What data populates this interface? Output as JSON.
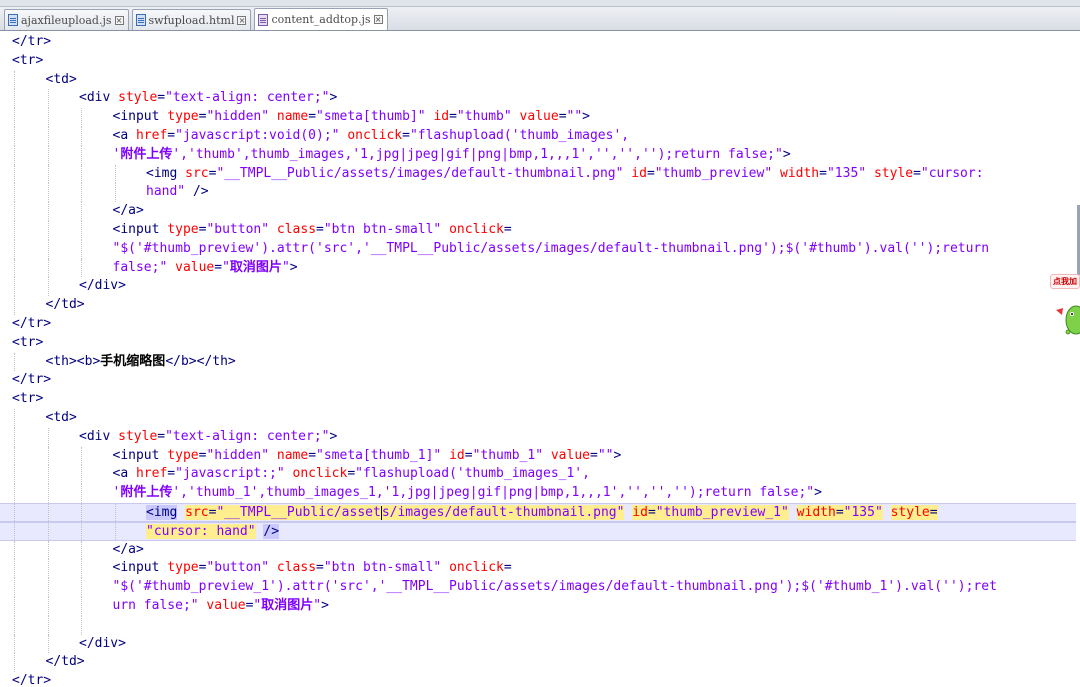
{
  "tabs": [
    {
      "label": "ajaxfileupload.js",
      "icon": "file-js-icon"
    },
    {
      "label": "swfupload.html",
      "icon": "file-html-icon"
    },
    {
      "label": "content_addtop.js",
      "icon": "file-js-icon"
    }
  ],
  "side_badge": "点我加",
  "colors": {
    "tag": "#000080",
    "attribute": "#ff0000",
    "value": "#8000ff",
    "current_line": "#e8e8ff",
    "highlight": "#ffee8f"
  },
  "code_lines": [
    {
      "indent": 0,
      "tokens": [
        {
          "c": "t",
          "x": "</tr>"
        }
      ]
    },
    {
      "indent": 0,
      "tokens": [
        {
          "c": "t",
          "x": "<tr>"
        }
      ]
    },
    {
      "indent": 1,
      "tokens": [
        {
          "c": "t",
          "x": "<td>"
        }
      ]
    },
    {
      "indent": 2,
      "tokens": [
        {
          "c": "t",
          "x": "<div "
        },
        {
          "c": "a",
          "x": "style"
        },
        {
          "c": "t",
          "x": "="
        },
        {
          "c": "v",
          "x": "\"text-align: center;\""
        },
        {
          "c": "t",
          "x": ">"
        }
      ]
    },
    {
      "indent": 3,
      "tokens": [
        {
          "c": "t",
          "x": "<input "
        },
        {
          "c": "a",
          "x": "type"
        },
        {
          "c": "t",
          "x": "="
        },
        {
          "c": "v",
          "x": "\"hidden\""
        },
        {
          "c": "t",
          "x": " "
        },
        {
          "c": "a",
          "x": "name"
        },
        {
          "c": "t",
          "x": "="
        },
        {
          "c": "v",
          "x": "\"smeta[thumb]\""
        },
        {
          "c": "t",
          "x": " "
        },
        {
          "c": "a",
          "x": "id"
        },
        {
          "c": "t",
          "x": "="
        },
        {
          "c": "v",
          "x": "\"thumb\""
        },
        {
          "c": "t",
          "x": " "
        },
        {
          "c": "a",
          "x": "value"
        },
        {
          "c": "t",
          "x": "="
        },
        {
          "c": "v",
          "x": "\"\""
        },
        {
          "c": "t",
          "x": ">"
        }
      ]
    },
    {
      "indent": 3,
      "tokens": [
        {
          "c": "t",
          "x": "<a "
        },
        {
          "c": "a",
          "x": "href"
        },
        {
          "c": "t",
          "x": "="
        },
        {
          "c": "v",
          "x": "\"javascript:void(0);\""
        },
        {
          "c": "t",
          "x": " "
        },
        {
          "c": "a",
          "x": "onclick"
        },
        {
          "c": "t",
          "x": "="
        },
        {
          "c": "v",
          "x": "\"flashupload('thumb_images',"
        }
      ]
    },
    {
      "indent": 3,
      "tokens": [
        {
          "c": "v",
          "x": "'"
        },
        {
          "c": "cjkv",
          "x": "附件上传"
        },
        {
          "c": "v",
          "x": "','thumb',thumb_images,'1,jpg|jpeg|gif|png|bmp,1,,,1','','','');return false;\""
        },
        {
          "c": "t",
          "x": ">"
        }
      ]
    },
    {
      "indent": 4,
      "tokens": [
        {
          "c": "t",
          "x": "<img "
        },
        {
          "c": "a",
          "x": "src"
        },
        {
          "c": "t",
          "x": "="
        },
        {
          "c": "v",
          "x": "\"__TMPL__Public/assets/images/default-thumbnail.png\""
        },
        {
          "c": "t",
          "x": " "
        },
        {
          "c": "a",
          "x": "id"
        },
        {
          "c": "t",
          "x": "="
        },
        {
          "c": "v",
          "x": "\"thumb_preview\""
        },
        {
          "c": "t",
          "x": " "
        },
        {
          "c": "a",
          "x": "width"
        },
        {
          "c": "t",
          "x": "="
        },
        {
          "c": "v",
          "x": "\"135\""
        },
        {
          "c": "t",
          "x": " "
        },
        {
          "c": "a",
          "x": "style"
        },
        {
          "c": "t",
          "x": "="
        },
        {
          "c": "v",
          "x": "\"cursor:"
        }
      ]
    },
    {
      "indent": 4,
      "tokens": [
        {
          "c": "v",
          "x": "hand\""
        },
        {
          "c": "t",
          "x": " />"
        }
      ]
    },
    {
      "indent": 3,
      "tokens": [
        {
          "c": "t",
          "x": "</a>"
        }
      ]
    },
    {
      "indent": 3,
      "tokens": [
        {
          "c": "t",
          "x": "<input "
        },
        {
          "c": "a",
          "x": "type"
        },
        {
          "c": "t",
          "x": "="
        },
        {
          "c": "v",
          "x": "\"button\""
        },
        {
          "c": "t",
          "x": " "
        },
        {
          "c": "a",
          "x": "class"
        },
        {
          "c": "t",
          "x": "="
        },
        {
          "c": "v",
          "x": "\"btn btn-small\""
        },
        {
          "c": "t",
          "x": " "
        },
        {
          "c": "a",
          "x": "onclick"
        },
        {
          "c": "t",
          "x": "="
        }
      ]
    },
    {
      "indent": 3,
      "tokens": [
        {
          "c": "v",
          "x": "\"$('#thumb_preview').attr('src','__TMPL__Public/assets/images/default-thumbnail.png');$('#thumb').val('');return"
        }
      ]
    },
    {
      "indent": 3,
      "tokens": [
        {
          "c": "v",
          "x": "false;\""
        },
        {
          "c": "t",
          "x": " "
        },
        {
          "c": "a",
          "x": "value"
        },
        {
          "c": "t",
          "x": "="
        },
        {
          "c": "v",
          "x": "\""
        },
        {
          "c": "cjkv",
          "x": "取消图片"
        },
        {
          "c": "v",
          "x": "\""
        },
        {
          "c": "t",
          "x": ">"
        }
      ]
    },
    {
      "indent": 2,
      "tokens": [
        {
          "c": "t",
          "x": "</div>"
        }
      ]
    },
    {
      "indent": 1,
      "tokens": [
        {
          "c": "t",
          "x": "</td>"
        }
      ]
    },
    {
      "indent": 0,
      "tokens": [
        {
          "c": "t",
          "x": "</tr>"
        }
      ]
    },
    {
      "indent": 0,
      "tokens": [
        {
          "c": "t",
          "x": "<tr>"
        }
      ]
    },
    {
      "indent": 1,
      "tokens": [
        {
          "c": "t",
          "x": "<th><b>"
        },
        {
          "c": "cjk",
          "x": "手机缩略图"
        },
        {
          "c": "t",
          "x": "</b></th>"
        }
      ]
    },
    {
      "indent": 0,
      "tokens": [
        {
          "c": "t",
          "x": "</tr>"
        }
      ]
    },
    {
      "indent": 0,
      "tokens": [
        {
          "c": "t",
          "x": "<tr>"
        }
      ]
    },
    {
      "indent": 1,
      "tokens": [
        {
          "c": "t",
          "x": "<td>"
        }
      ]
    },
    {
      "indent": 2,
      "tokens": [
        {
          "c": "t",
          "x": "<div "
        },
        {
          "c": "a",
          "x": "style"
        },
        {
          "c": "t",
          "x": "="
        },
        {
          "c": "v",
          "x": "\"text-align: center;\""
        },
        {
          "c": "t",
          "x": ">"
        }
      ]
    },
    {
      "indent": 3,
      "tokens": [
        {
          "c": "t",
          "x": "<input "
        },
        {
          "c": "a",
          "x": "type"
        },
        {
          "c": "t",
          "x": "="
        },
        {
          "c": "v",
          "x": "\"hidden\""
        },
        {
          "c": "t",
          "x": " "
        },
        {
          "c": "a",
          "x": "name"
        },
        {
          "c": "t",
          "x": "="
        },
        {
          "c": "v",
          "x": "\"smeta[thumb_1]\""
        },
        {
          "c": "t",
          "x": " "
        },
        {
          "c": "a",
          "x": "id"
        },
        {
          "c": "t",
          "x": "="
        },
        {
          "c": "v",
          "x": "\"thumb_1\""
        },
        {
          "c": "t",
          "x": " "
        },
        {
          "c": "a",
          "x": "value"
        },
        {
          "c": "t",
          "x": "="
        },
        {
          "c": "v",
          "x": "\"\""
        },
        {
          "c": "t",
          "x": ">"
        }
      ]
    },
    {
      "indent": 3,
      "tokens": [
        {
          "c": "t",
          "x": "<a "
        },
        {
          "c": "a",
          "x": "href"
        },
        {
          "c": "t",
          "x": "="
        },
        {
          "c": "v",
          "x": "\"javascript:;\""
        },
        {
          "c": "t",
          "x": " "
        },
        {
          "c": "a",
          "x": "onclick"
        },
        {
          "c": "t",
          "x": "="
        },
        {
          "c": "v",
          "x": "\"flashupload('thumb_images_1',"
        }
      ]
    },
    {
      "indent": 3,
      "tokens": [
        {
          "c": "v",
          "x": "'"
        },
        {
          "c": "cjkv",
          "x": "附件上传"
        },
        {
          "c": "v",
          "x": "','thumb_1',thumb_images_1,'1,jpg|jpeg|gif|png|bmp,1,,,1','','','');return false;\""
        },
        {
          "c": "t",
          "x": ">"
        }
      ]
    },
    {
      "indent": 4,
      "current": true,
      "tokens": [
        {
          "c": "t hl-tag",
          "x": "<img"
        },
        {
          "c": "t",
          "x": " "
        },
        {
          "c": "a hl",
          "x": "src"
        },
        {
          "c": "t hl",
          "x": "="
        },
        {
          "c": "v hl",
          "x": "\"__TMPL__Public/asset"
        },
        {
          "c": "caret",
          "x": ""
        },
        {
          "c": "v hl",
          "x": "s/images/default-thumbnail.png\""
        },
        {
          "c": "t",
          "x": " "
        },
        {
          "c": "a hl",
          "x": "id"
        },
        {
          "c": "t hl",
          "x": "="
        },
        {
          "c": "v hl",
          "x": "\"thumb_preview_1\""
        },
        {
          "c": "t",
          "x": " "
        },
        {
          "c": "a hl",
          "x": "width"
        },
        {
          "c": "t hl",
          "x": "="
        },
        {
          "c": "v hl",
          "x": "\"135\""
        },
        {
          "c": "t",
          "x": " "
        },
        {
          "c": "a hl",
          "x": "style"
        },
        {
          "c": "t hl",
          "x": "="
        }
      ]
    },
    {
      "indent": 4,
      "current": true,
      "tokens": [
        {
          "c": "v hl",
          "x": "\"cursor: hand\""
        },
        {
          "c": "t",
          "x": " "
        },
        {
          "c": "t hl-tag",
          "x": "/>"
        }
      ]
    },
    {
      "indent": 3,
      "tokens": [
        {
          "c": "t",
          "x": "</a>"
        }
      ]
    },
    {
      "indent": 3,
      "tokens": [
        {
          "c": "t",
          "x": "<input "
        },
        {
          "c": "a",
          "x": "type"
        },
        {
          "c": "t",
          "x": "="
        },
        {
          "c": "v",
          "x": "\"button\""
        },
        {
          "c": "t",
          "x": " "
        },
        {
          "c": "a",
          "x": "class"
        },
        {
          "c": "t",
          "x": "="
        },
        {
          "c": "v",
          "x": "\"btn btn-small\""
        },
        {
          "c": "t",
          "x": " "
        },
        {
          "c": "a",
          "x": "onclick"
        },
        {
          "c": "t",
          "x": "="
        }
      ]
    },
    {
      "indent": 3,
      "tokens": [
        {
          "c": "v",
          "x": "\"$('#thumb_preview_1').attr('src','__TMPL__Public/assets/images/default-thumbnail.png');$('#thumb_1').val('');ret"
        }
      ]
    },
    {
      "indent": 3,
      "tokens": [
        {
          "c": "v",
          "x": "urn false;\""
        },
        {
          "c": "t",
          "x": " "
        },
        {
          "c": "a",
          "x": "value"
        },
        {
          "c": "t",
          "x": "="
        },
        {
          "c": "v",
          "x": "\""
        },
        {
          "c": "cjkv",
          "x": "取消图片"
        },
        {
          "c": "v",
          "x": "\""
        },
        {
          "c": "t",
          "x": ">"
        }
      ]
    },
    {
      "indent": 3,
      "tokens": []
    },
    {
      "indent": 2,
      "tokens": [
        {
          "c": "t",
          "x": "</div>"
        }
      ]
    },
    {
      "indent": 1,
      "tokens": [
        {
          "c": "t",
          "x": "</td>"
        }
      ]
    },
    {
      "indent": 0,
      "tokens": [
        {
          "c": "t",
          "x": "</tr>"
        }
      ]
    }
  ]
}
